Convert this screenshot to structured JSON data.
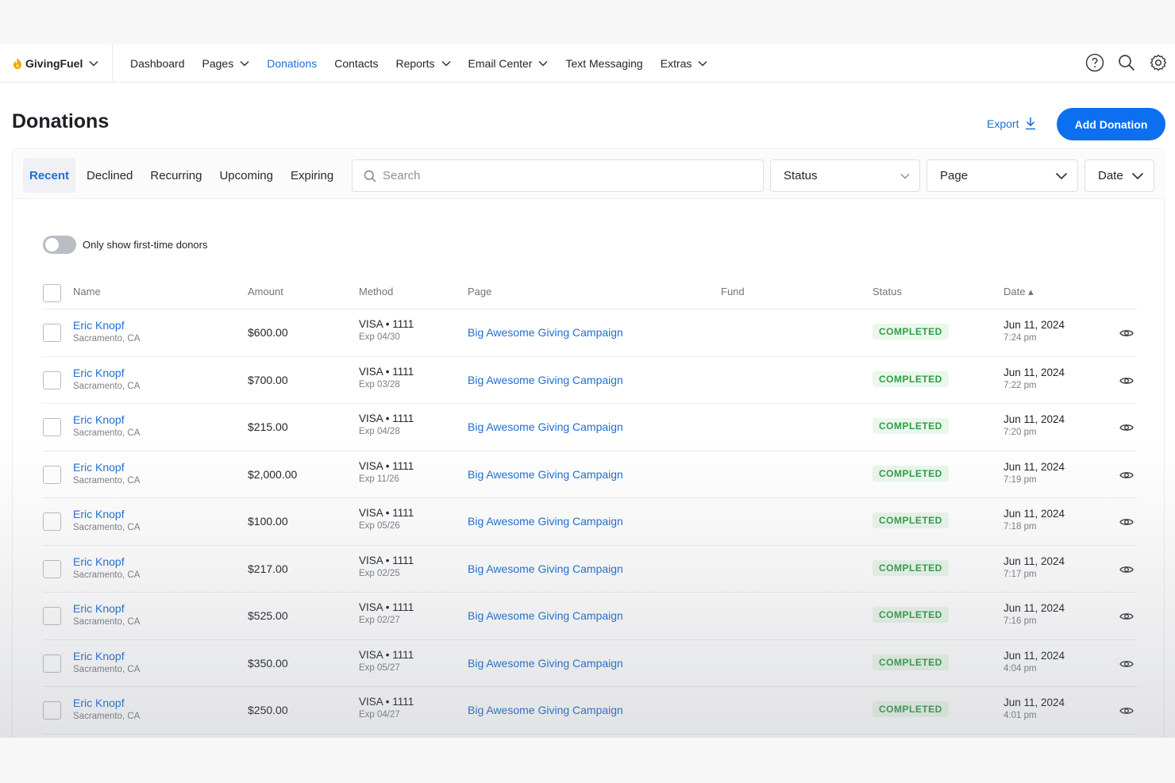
{
  "nav": {
    "brand": "GivingFuel",
    "links": [
      {
        "label": "Dashboard",
        "dropdown": false,
        "active": false
      },
      {
        "label": "Pages",
        "dropdown": true,
        "active": false
      },
      {
        "label": "Donations",
        "dropdown": false,
        "active": true
      },
      {
        "label": "Contacts",
        "dropdown": false,
        "active": false
      },
      {
        "label": "Reports",
        "dropdown": true,
        "active": false
      },
      {
        "label": "Email Center",
        "dropdown": true,
        "active": false
      },
      {
        "label": "Text Messaging",
        "dropdown": false,
        "active": false
      },
      {
        "label": "Extras",
        "dropdown": true,
        "active": false
      }
    ],
    "icons": [
      "help-icon",
      "search-icon",
      "gear-icon"
    ]
  },
  "header": {
    "title": "Donations",
    "export_label": "Export",
    "add_label": "Add Donation"
  },
  "filters": {
    "tabs": [
      {
        "label": "Recent",
        "active": true
      },
      {
        "label": "Declined",
        "active": false
      },
      {
        "label": "Recurring",
        "active": false
      },
      {
        "label": "Upcoming",
        "active": false
      },
      {
        "label": "Expiring",
        "active": false
      }
    ],
    "search_placeholder": "Search",
    "status_label": "Status",
    "page_label": "Page",
    "date_label": "Date"
  },
  "toggle": {
    "label": "Only show first-time donors",
    "on": false
  },
  "table": {
    "columns": {
      "name": "Name",
      "amount": "Amount",
      "method": "Method",
      "page": "Page",
      "fund": "Fund",
      "status": "Status",
      "date": "Date ▴"
    },
    "rows": [
      {
        "name": "Eric Knopf",
        "location": "Sacramento, CA",
        "amount": "$600.00",
        "method": "VISA • 1111",
        "exp": "Exp 04/30",
        "page": "Big Awesome Giving Campaign",
        "fund": "",
        "status": "COMPLETED",
        "date": "Jun 11, 2024",
        "time": "7:24 pm"
      },
      {
        "name": "Eric Knopf",
        "location": "Sacramento, CA",
        "amount": "$700.00",
        "method": "VISA • 1111",
        "exp": "Exp 03/28",
        "page": "Big Awesome Giving Campaign",
        "fund": "",
        "status": "COMPLETED",
        "date": "Jun 11, 2024",
        "time": "7:22 pm"
      },
      {
        "name": "Eric Knopf",
        "location": "Sacramento, CA",
        "amount": "$215.00",
        "method": "VISA • 1111",
        "exp": "Exp 04/28",
        "page": "Big Awesome Giving Campaign",
        "fund": "",
        "status": "COMPLETED",
        "date": "Jun 11, 2024",
        "time": "7:20 pm"
      },
      {
        "name": "Eric Knopf",
        "location": "Sacramento, CA",
        "amount": "$2,000.00",
        "method": "VISA • 1111",
        "exp": "Exp 11/26",
        "page": "Big Awesome Giving Campaign",
        "fund": "",
        "status": "COMPLETED",
        "date": "Jun 11, 2024",
        "time": "7:19 pm"
      },
      {
        "name": "Eric Knopf",
        "location": "Sacramento, CA",
        "amount": "$100.00",
        "method": "VISA • 1111",
        "exp": "Exp 05/26",
        "page": "Big Awesome Giving Campaign",
        "fund": "",
        "status": "COMPLETED",
        "date": "Jun 11, 2024",
        "time": "7:18 pm"
      },
      {
        "name": "Eric Knopf",
        "location": "Sacramento, CA",
        "amount": "$217.00",
        "method": "VISA • 1111",
        "exp": "Exp 02/25",
        "page": "Big Awesome Giving Campaign",
        "fund": "",
        "status": "COMPLETED",
        "date": "Jun 11, 2024",
        "time": "7:17 pm"
      },
      {
        "name": "Eric Knopf",
        "location": "Sacramento, CA",
        "amount": "$525.00",
        "method": "VISA • 1111",
        "exp": "Exp 02/27",
        "page": "Big Awesome Giving Campaign",
        "fund": "",
        "status": "COMPLETED",
        "date": "Jun 11, 2024",
        "time": "7:16 pm"
      },
      {
        "name": "Eric Knopf",
        "location": "Sacramento, CA",
        "amount": "$350.00",
        "method": "VISA • 1111",
        "exp": "Exp 05/27",
        "page": "Big Awesome Giving Campaign",
        "fund": "",
        "status": "COMPLETED",
        "date": "Jun 11, 2024",
        "time": "4:04 pm"
      },
      {
        "name": "Eric Knopf",
        "location": "Sacramento, CA",
        "amount": "$250.00",
        "method": "VISA • 1111",
        "exp": "Exp 04/27",
        "page": "Big Awesome Giving Campaign",
        "fund": "",
        "status": "COMPLETED",
        "date": "Jun 11, 2024",
        "time": "4:01 pm"
      }
    ]
  },
  "colors": {
    "accent": "#1f6fd1",
    "primary_button": "#0b6ff0",
    "status_completed": "#2f9e44",
    "brand_flame": "#f5a300"
  }
}
